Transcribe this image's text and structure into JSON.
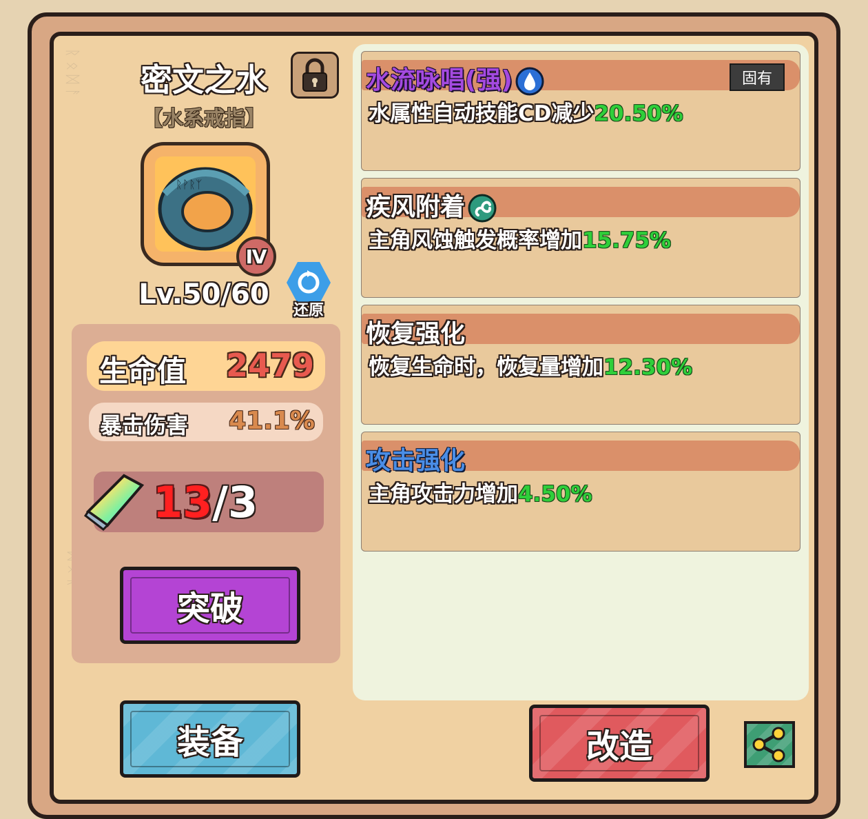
{
  "item": {
    "name": "密文之水",
    "type": "【水系戒指】",
    "rarity": "Ⅳ",
    "level": "Lv.50/60",
    "locked": true,
    "restore_label": "还原"
  },
  "stats": {
    "hp_label": "生命值",
    "hp_value": "2479",
    "crit_label": "暴击伤害",
    "crit_value": "41.1%"
  },
  "crystals": {
    "current": "13",
    "separator": "/",
    "required": "3"
  },
  "buttons": {
    "breakthrough": "突破",
    "equip": "装备",
    "reforge": "改造"
  },
  "affixes": [
    {
      "title": "水流咏唱(强)",
      "element": "water",
      "tag": "固有",
      "desc": "水属性自动技能CD减少",
      "value": "20.50%"
    },
    {
      "title": "疾风附着",
      "element": "wind",
      "desc": "主角风蚀触发概率增加",
      "value": "15.75%"
    },
    {
      "title": "恢复强化",
      "desc": "恢复生命时，恢复量增加",
      "value": "12.30%"
    },
    {
      "title": "攻击强化",
      "desc": "主角攻击力增加",
      "value": "4.50%"
    }
  ],
  "colors": {
    "panel_bg": "#f0d1a2",
    "affix_header": "#da906a",
    "value_green": "#2fcf3a",
    "hp_red": "#e85a4f",
    "break_purple": "#b444d4",
    "equip_blue": "#5fb8d6",
    "reforge_red": "#e05a5e",
    "share_green": "#3e9e74"
  },
  "icons": [
    "lock-icon",
    "ring-icon",
    "restore-icon",
    "crystal-icon",
    "water-drop-icon",
    "wind-swirl-icon",
    "share-icon"
  ]
}
